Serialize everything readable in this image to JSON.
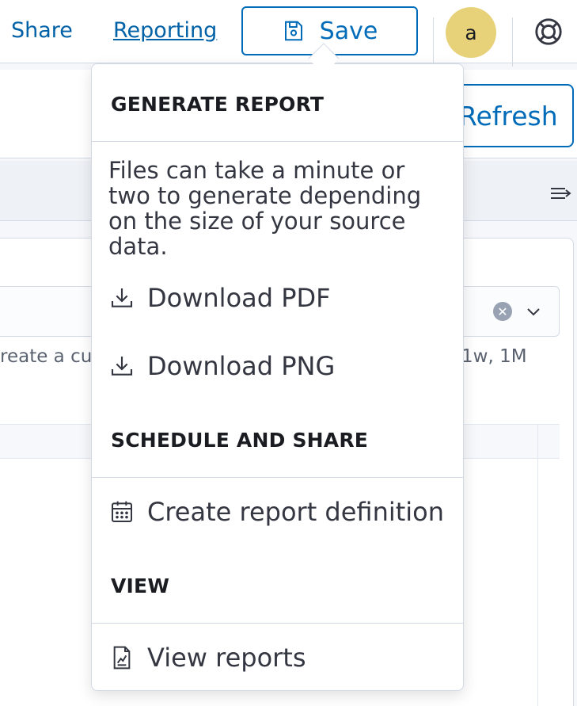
{
  "header": {
    "share_label": "Share",
    "reporting_label": "Reporting",
    "save_label": "Save",
    "avatar_initial": "a"
  },
  "toolbar": {
    "refresh_label": "Refresh"
  },
  "background": {
    "help_text_left": "reate a cu",
    "help_text_right": "1w, 1M"
  },
  "popover": {
    "generate_title": "GENERATE REPORT",
    "description": "Files can take a minute or two to generate depending on the size of your source data.",
    "download_pdf": "Download PDF",
    "download_png": "Download PNG",
    "schedule_title": "SCHEDULE AND SHARE",
    "create_definition": "Create report definition",
    "view_title": "VIEW",
    "view_reports": "View reports"
  },
  "icons": {
    "save": "save-icon",
    "help": "help-lifebuoy-icon",
    "download": "download-icon",
    "calendar": "calendar-icon",
    "report": "report-icon"
  },
  "colors": {
    "link": "#0061a6",
    "primary": "#006bb8",
    "avatar": "#e7d27a",
    "border": "#d3dae6"
  }
}
